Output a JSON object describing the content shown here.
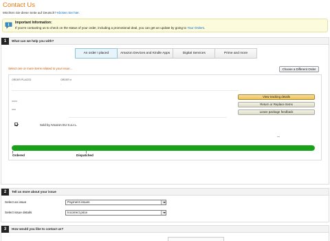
{
  "page": {
    "title": "Contact Us",
    "deutsch_prefix": "Möchten Sie diese Seite auf Deutsch?",
    "deutsch_link": "Klicken Sie hier."
  },
  "info": {
    "title": "Important Information:",
    "body_prefix": "If you're contacting us to check on the status of your order, including a promotional deal, you can get an update by going to",
    "body_link": "Your Orders",
    "body_suffix": "."
  },
  "step1": {
    "number": "1",
    "label": "What can we help you with?",
    "tabs": [
      {
        "label": "An order I placed",
        "active": true
      },
      {
        "label": "Amazon Devices and Kindle Apps",
        "active": false
      },
      {
        "label": "Digital Services",
        "active": false
      },
      {
        "label": "Prime and more",
        "active": false
      }
    ],
    "select_prompt": "Select one or more items related to your issue...",
    "choose_button": "Choose a Different Order",
    "order": {
      "placed_label": "ORDER PLACED",
      "number_label": "ORDER #",
      "placed_value": "-",
      "number_value": "-",
      "actions": {
        "track": "View tracking details",
        "return": "Return or Replace Items",
        "feedback": "Leave package feedback"
      },
      "seller": "Sold by Amazon EU S.a.r.L.",
      "item_checked": true,
      "progress": 1.0,
      "milestones": {
        "ordered": "Ordered",
        "dispatched": "Dispatched"
      }
    }
  },
  "step2": {
    "number": "2",
    "label": "Tell us more about your issue",
    "issue_label": "Select an issue",
    "issue_value": "Payment issues",
    "details_label": "Select issue details",
    "details_value": "Incorrect price"
  },
  "step3": {
    "number": "3",
    "label": "How would you like to contact us?"
  },
  "colors": {
    "title": "#e47911",
    "link": "#0066c0",
    "progress": "#19a119",
    "tracking_button": "#f0c14b"
  }
}
